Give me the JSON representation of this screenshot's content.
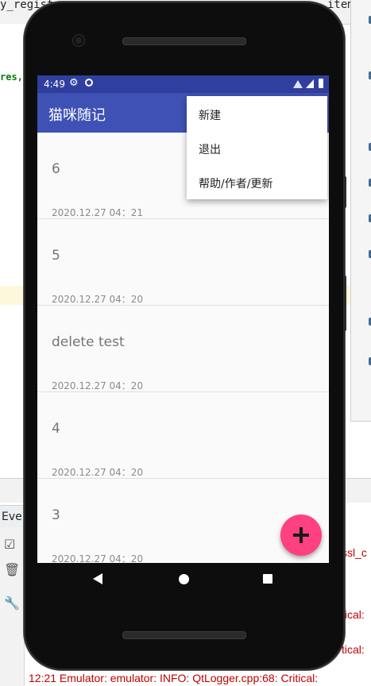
{
  "ide": {
    "top_tab_left": "y_regist",
    "top_tab_right": "item",
    "code_snippet": "res,",
    "events_tab": "Even",
    "log_snippet_1": "ssl_c",
    "log_snippet_2": "tical:",
    "log_snippet_3": "tical:",
    "log_bottom": "12:21  Emulator: emulator: INFO: QtLogger.cpp:68: Critical:"
  },
  "status_bar": {
    "time": "4:49"
  },
  "app_bar": {
    "title": "猫咪随记"
  },
  "notes": [
    {
      "title": "6",
      "date": "2020.12.27 04：21"
    },
    {
      "title": "5",
      "date": "2020.12.27 04：20"
    },
    {
      "title": "delete test",
      "date": "2020.12.27 04：20"
    },
    {
      "title": "4",
      "date": "2020.12.27 04：20"
    },
    {
      "title": "3",
      "date": "2020.12.27 04：20"
    }
  ],
  "menu": {
    "items": [
      "新建",
      "退出",
      "帮助/作者/更新"
    ]
  },
  "colors": {
    "primary": "#3f51b5",
    "primary_dark": "#303f9f",
    "accent": "#ff4081"
  },
  "icons": {
    "fab": "add-icon",
    "nav": [
      "back-icon",
      "home-icon",
      "recents-icon"
    ]
  }
}
